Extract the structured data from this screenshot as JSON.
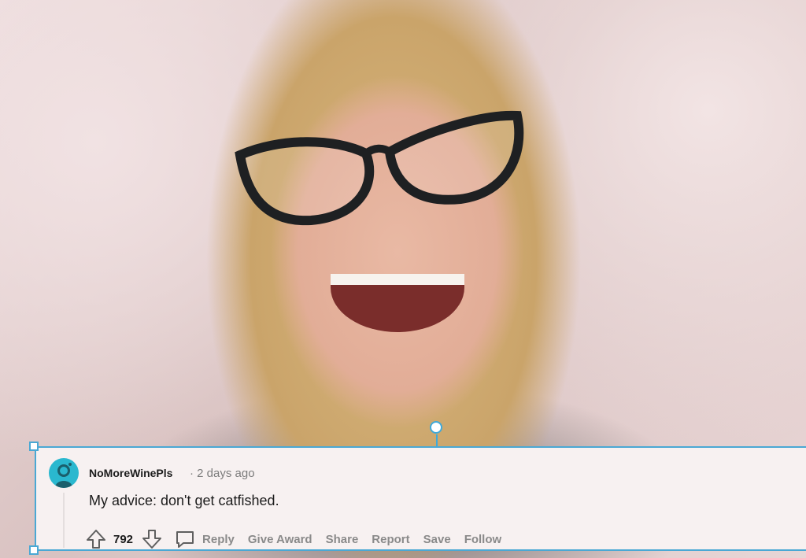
{
  "comment": {
    "author": "NoMoreWinePls",
    "separator": "·",
    "time": "2 days ago",
    "body": "My advice: don't get catfished.",
    "votes": "792",
    "actions": {
      "reply": "Reply",
      "give_award": "Give Award",
      "share": "Share",
      "report": "Report",
      "save": "Save",
      "follow": "Follow"
    }
  },
  "icons": {
    "upvote": "arrow-up-icon",
    "downvote": "arrow-down-icon",
    "reply": "speech-bubble-icon",
    "avatar": "snoo-avatar"
  },
  "colors": {
    "selection": "#4aa8d4",
    "avatar_bg": "#2ab8cf",
    "card_bg": "#f7f1f1"
  }
}
